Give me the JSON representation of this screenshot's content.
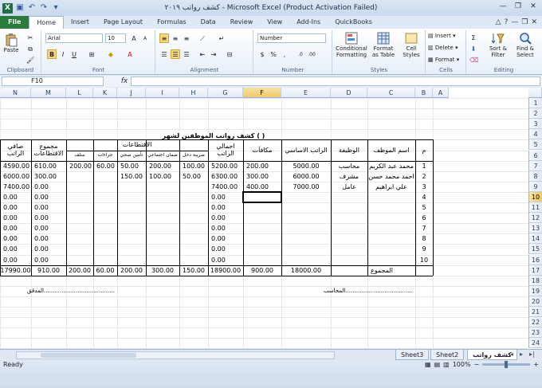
{
  "window": {
    "title": "كشف رواتب ٢٠١٩ - Microsoft Excel (Product Activation Failed)",
    "app_icon": "X"
  },
  "ribbon_tabs": [
    "File",
    "Home",
    "Insert",
    "Page Layout",
    "Formulas",
    "Data",
    "Review",
    "View",
    "Add-Ins",
    "QuickBooks"
  ],
  "clipboard": {
    "paste": "Paste",
    "label": "Clipboard"
  },
  "font": {
    "name": "Arial",
    "size": "10",
    "label": "Font"
  },
  "alignment": {
    "label": "Alignment"
  },
  "number": {
    "format": "Number",
    "label": "Number"
  },
  "styles": {
    "conditional": "Conditional Formatting",
    "format_table": "Format as Table",
    "cell_styles": "Cell Styles",
    "label": "Styles"
  },
  "cells": {
    "insert": "Insert",
    "delete": "Delete",
    "format": "Format",
    "label": "Cells"
  },
  "editing": {
    "sort": "Sort & Filter",
    "find": "Find & Select",
    "label": "Editing"
  },
  "formula_bar": {
    "name_box": "F10",
    "fx": "fx",
    "value": ""
  },
  "columns": [
    "N",
    "M",
    "L",
    "K",
    "J",
    "I",
    "H",
    "G",
    "F",
    "E",
    "D",
    "C",
    "B",
    "A"
  ],
  "rows": [
    "1",
    "2",
    "3",
    "4",
    "5",
    "6",
    "7",
    "8",
    "9",
    "10",
    "11",
    "12",
    "13",
    "14",
    "15",
    "16",
    "17",
    "18",
    "19",
    "20",
    "21",
    "22",
    "23",
    "24"
  ],
  "sheet": {
    "title": "كشف رواتب الموظفين لشهر  (    )",
    "headers": {
      "index": "م",
      "name": "اسم الموظف",
      "job": "الوظيفة",
      "basic": "الراتب الاساسي",
      "bonus": "مكافآت",
      "gross": "اجمالي الراتب",
      "deductions": "الاقتطاعات",
      "income_tax": "ضريبة دخل",
      "social": "ضمان اجتماعي",
      "health": "تأمين صحي",
      "penalties": "جزاءات",
      "advance": "سلف",
      "total_ded": "مجموع الاقتطاعات",
      "net": "صافي الراتب"
    },
    "rows": [
      {
        "i": "1",
        "name": "محمد عبد الكريم",
        "job": "محاسب",
        "basic": "5000.00",
        "bonus": "200.00",
        "gross": "5200.00",
        "tax": "100.00",
        "social": "200.00",
        "health": "50.00",
        "pen": "60.00",
        "adv": "200.00",
        "tded": "610.00",
        "net": "4590.00"
      },
      {
        "i": "2",
        "name": "احمد محمد حسن",
        "job": "مشرف",
        "basic": "6000.00",
        "bonus": "300.00",
        "gross": "6300.00",
        "tax": "50.00",
        "social": "100.00",
        "health": "150.00",
        "pen": "",
        "adv": "",
        "tded": "300.00",
        "net": "6000.00"
      },
      {
        "i": "3",
        "name": "علي ابراهيم",
        "job": "عامل",
        "basic": "7000.00",
        "bonus": "400.00",
        "gross": "7400.00",
        "tax": "",
        "social": "",
        "health": "",
        "pen": "",
        "adv": "",
        "tded": "0.00",
        "net": "7400.00"
      },
      {
        "i": "4",
        "name": "",
        "job": "",
        "basic": "",
        "bonus": "",
        "gross": "0.00",
        "tax": "",
        "social": "",
        "health": "",
        "pen": "",
        "adv": "",
        "tded": "0.00",
        "net": "0.00"
      },
      {
        "i": "5",
        "name": "",
        "job": "",
        "basic": "",
        "bonus": "",
        "gross": "0.00",
        "tax": "",
        "social": "",
        "health": "",
        "pen": "",
        "adv": "",
        "tded": "0.00",
        "net": "0.00"
      },
      {
        "i": "6",
        "name": "",
        "job": "",
        "basic": "",
        "bonus": "",
        "gross": "0.00",
        "tax": "",
        "social": "",
        "health": "",
        "pen": "",
        "adv": "",
        "tded": "0.00",
        "net": "0.00"
      },
      {
        "i": "7",
        "name": "",
        "job": "",
        "basic": "",
        "bonus": "",
        "gross": "0.00",
        "tax": "",
        "social": "",
        "health": "",
        "pen": "",
        "adv": "",
        "tded": "0.00",
        "net": "0.00"
      },
      {
        "i": "8",
        "name": "",
        "job": "",
        "basic": "",
        "bonus": "",
        "gross": "0.00",
        "tax": "",
        "social": "",
        "health": "",
        "pen": "",
        "adv": "",
        "tded": "0.00",
        "net": "0.00"
      },
      {
        "i": "9",
        "name": "",
        "job": "",
        "basic": "",
        "bonus": "",
        "gross": "0.00",
        "tax": "",
        "social": "",
        "health": "",
        "pen": "",
        "adv": "",
        "tded": "0.00",
        "net": "0.00"
      },
      {
        "i": "10",
        "name": "",
        "job": "",
        "basic": "",
        "bonus": "",
        "gross": "0.00",
        "tax": "",
        "social": "",
        "health": "",
        "pen": "",
        "adv": "",
        "tded": "0.00",
        "net": "0.00"
      }
    ],
    "totals": {
      "label": "المجموع",
      "basic": "18000.00",
      "bonus": "900.00",
      "gross": "18900.00",
      "tax": "150.00",
      "social": "300.00",
      "health": "200.00",
      "pen": "60.00",
      "adv": "200.00",
      "tded": "910.00",
      "net": "17990.00"
    },
    "accountant": "المحاسب......................................",
    "auditor": "المدقق........................................"
  },
  "sheet_tabs": [
    "كشف رواتب",
    "Sheet2",
    "Sheet3"
  ],
  "status": {
    "ready": "Ready",
    "zoom": "100%"
  }
}
